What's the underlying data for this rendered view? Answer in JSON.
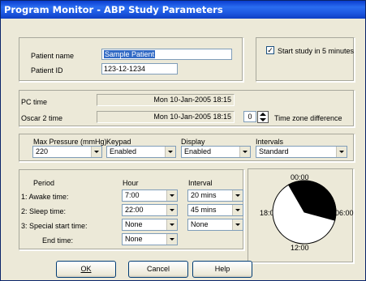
{
  "window": {
    "title": "Program Monitor - ABP Study Parameters"
  },
  "patient": {
    "name_label": "Patient name",
    "name_value": "Sample Patient",
    "id_label": "Patient ID",
    "id_value": "123-12-1234"
  },
  "start_study": {
    "label": "Start study in 5 minutes",
    "checked_mark": "✓"
  },
  "time": {
    "pc_label": "PC time",
    "pc_value": "Mon  10-Jan-2005 18:15",
    "oscar_label": "Oscar 2 time",
    "oscar_value": "Mon  10-Jan-2005 18:15",
    "tz_value": "0",
    "tz_label": "Time zone difference"
  },
  "settings": {
    "max_pressure_label": "Max Pressure (mmHg)",
    "max_pressure_value": "220",
    "keypad_label": "Keypad",
    "keypad_value": "Enabled",
    "display_label": "Display",
    "display_value": "Enabled",
    "intervals_label": "Intervals",
    "intervals_value": "Standard"
  },
  "periods": {
    "period_header": "Period",
    "hour_header": "Hour",
    "interval_header": "Interval",
    "awake_label": "1:  Awake time:",
    "awake_hour": "7:00",
    "awake_interval": "20 mins",
    "sleep_label": "2:  Sleep time:",
    "sleep_hour": "22:00",
    "sleep_interval": "45 mins",
    "special_label": "3:  Special start time:",
    "special_hour": "None",
    "special_interval": "None",
    "end_label": "End time:",
    "end_hour": "None"
  },
  "clock": {
    "top": "00:00",
    "right": "06:00",
    "bottom": "12:00",
    "left": "18:00",
    "awake_start": "7:00",
    "sleep_start": "22:00",
    "sleep_color": "#000000",
    "awake_color": "#ffffff"
  },
  "buttons": {
    "ok": "OK",
    "cancel": "Cancel",
    "help": "Help"
  }
}
